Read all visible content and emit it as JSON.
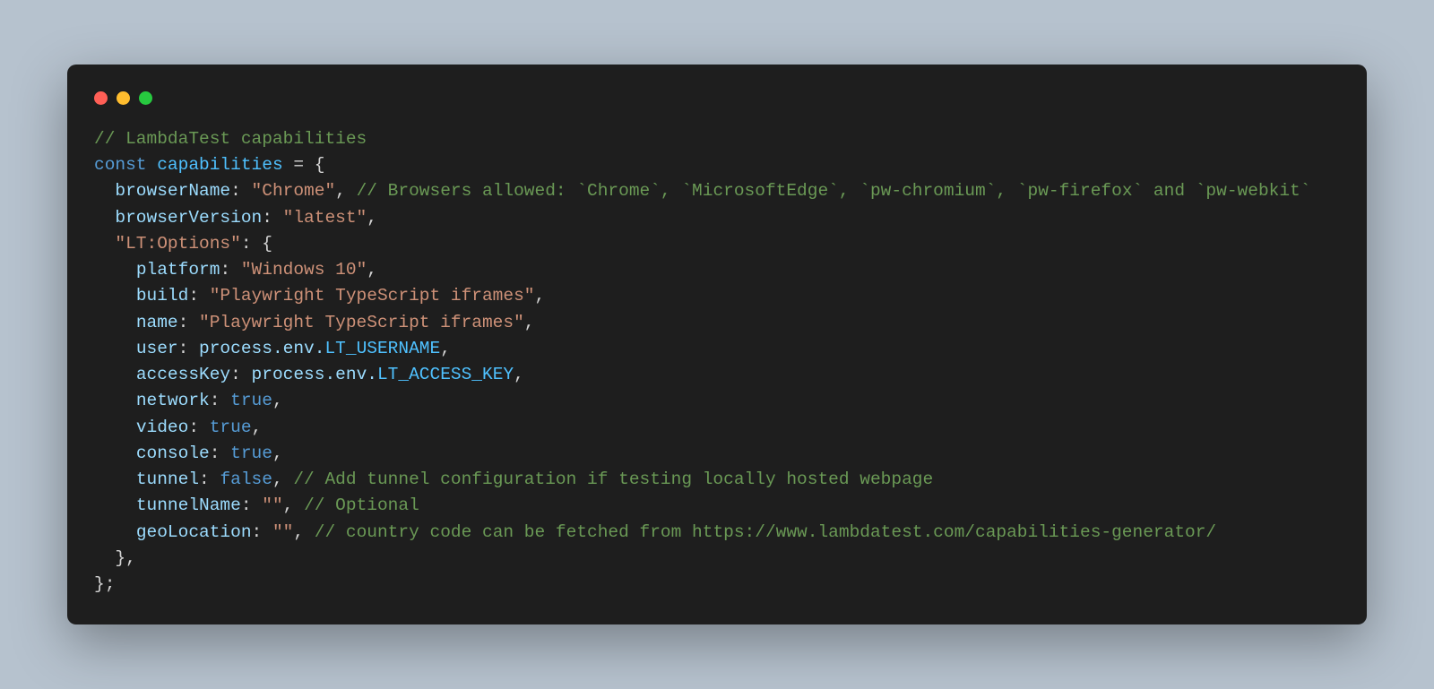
{
  "titlebar": {
    "red": "close",
    "yellow": "minimize",
    "green": "zoom"
  },
  "code": {
    "c_header": "// LambdaTest capabilities",
    "kw_const": "const",
    "var_name": "capabilities",
    "op_eq": " = ",
    "brace_open": "{",
    "indent1": "  ",
    "indent2": "    ",
    "k_browserName": "browserName",
    "v_browserName": "\"Chrome\"",
    "c_browsers": "// Browsers allowed: `Chrome`, `MicrosoftEdge`, `pw-chromium`, `pw-firefox` and `pw-webkit`",
    "k_browserVersion": "browserVersion",
    "v_browserVersion": "\"latest\"",
    "k_ltoptions": "\"LT:Options\"",
    "k_platform": "platform",
    "v_platform": "\"Windows 10\"",
    "k_build": "build",
    "v_build": "\"Playwright TypeScript iframes\"",
    "k_name": "name",
    "v_name": "\"Playwright TypeScript iframes\"",
    "k_user": "user",
    "v_user_pre": "process.env.",
    "v_user_const": "LT_USERNAME",
    "k_accessKey": "accessKey",
    "v_accessKey_pre": "process.env.",
    "v_accessKey_const": "LT_ACCESS_KEY",
    "k_network": "network",
    "v_true": "true",
    "k_video": "video",
    "k_console": "console",
    "k_tunnel": "tunnel",
    "v_false": "false",
    "c_tunnel": "// Add tunnel configuration if testing locally hosted webpage",
    "k_tunnelName": "tunnelName",
    "v_empty": "\"\"",
    "c_optional": "// Optional",
    "k_geoLocation": "geoLocation",
    "c_geo": "// country code can be fetched from https://www.lambdatest.com/capabilities-generator/",
    "brace_close_inner": "  },",
    "brace_close_outer": "};",
    "colon": ":",
    "comma": ",",
    "space": " "
  }
}
